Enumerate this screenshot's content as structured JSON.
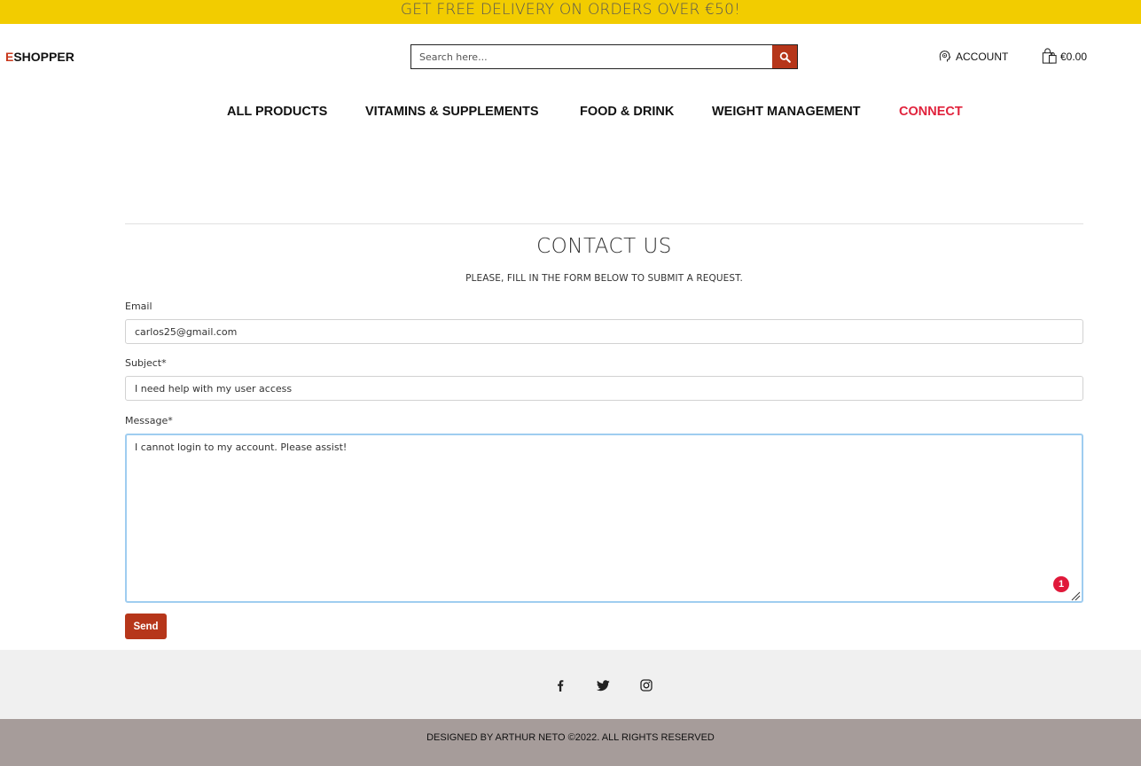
{
  "banner": {
    "text": "GET FREE DELIVERY ON ORDERS OVER €50!"
  },
  "header": {
    "logo_initial": "E",
    "logo_rest": "SHOPPER",
    "search_placeholder": "Search here...",
    "account_label": "ACCOUNT",
    "cart_total": "€0.00"
  },
  "nav": {
    "items": [
      {
        "label": "ALL PRODUCTS"
      },
      {
        "label": "VITAMINS & SUPPLEMENTS"
      },
      {
        "label": "FOOD & DRINK"
      },
      {
        "label": "WEIGHT MANAGEMENT"
      },
      {
        "label": "CONNECT"
      }
    ],
    "active": "CONNECT"
  },
  "contact": {
    "title": "CONTACT US",
    "subtitle": "PLEASE, FILL IN THE FORM BELOW TO SUBMIT A REQUEST.",
    "email_label": "Email",
    "email_value": "carlos25@gmail.com",
    "subject_label": "Subject*",
    "subject_value": "I need help with my user access",
    "message_label": "Message*",
    "message_value": "I cannot login to my account. Please assist!",
    "badge_count": "1",
    "send_label": "Send"
  },
  "social": {
    "icons": [
      "facebook-icon",
      "twitter-icon",
      "instagram-icon"
    ]
  },
  "footer": {
    "text": "DESIGNED BY ARTHUR NETO ©2022. ALL RIGHTS RESERVED"
  },
  "colors": {
    "banner": "#f2cc00",
    "accent": "#b6361a",
    "active_nav": "#e1223c",
    "footer": "#a69c9a",
    "social_bar": "#f0f0f0"
  }
}
